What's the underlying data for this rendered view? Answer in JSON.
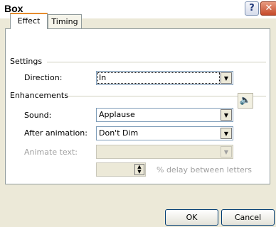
{
  "dialog": {
    "title": "Box"
  },
  "tabs": [
    {
      "label": "Effect"
    },
    {
      "label": "Timing"
    }
  ],
  "settings": {
    "group_label": "Settings",
    "direction_label": "Direction:",
    "direction_value": "In"
  },
  "enhancements": {
    "group_label": "Enhancements",
    "sound_label": "Sound:",
    "sound_value": "Applause",
    "after_label": "After animation:",
    "after_value": "Don't Dim",
    "animate_label": "Animate text:",
    "animate_value": "",
    "delay_value": "",
    "delay_label": "% delay between letters"
  },
  "buttons": {
    "ok": "OK",
    "cancel": "Cancel"
  },
  "icons": {
    "help": "question-icon",
    "close": "close-icon",
    "speaker": "speaker-icon"
  }
}
